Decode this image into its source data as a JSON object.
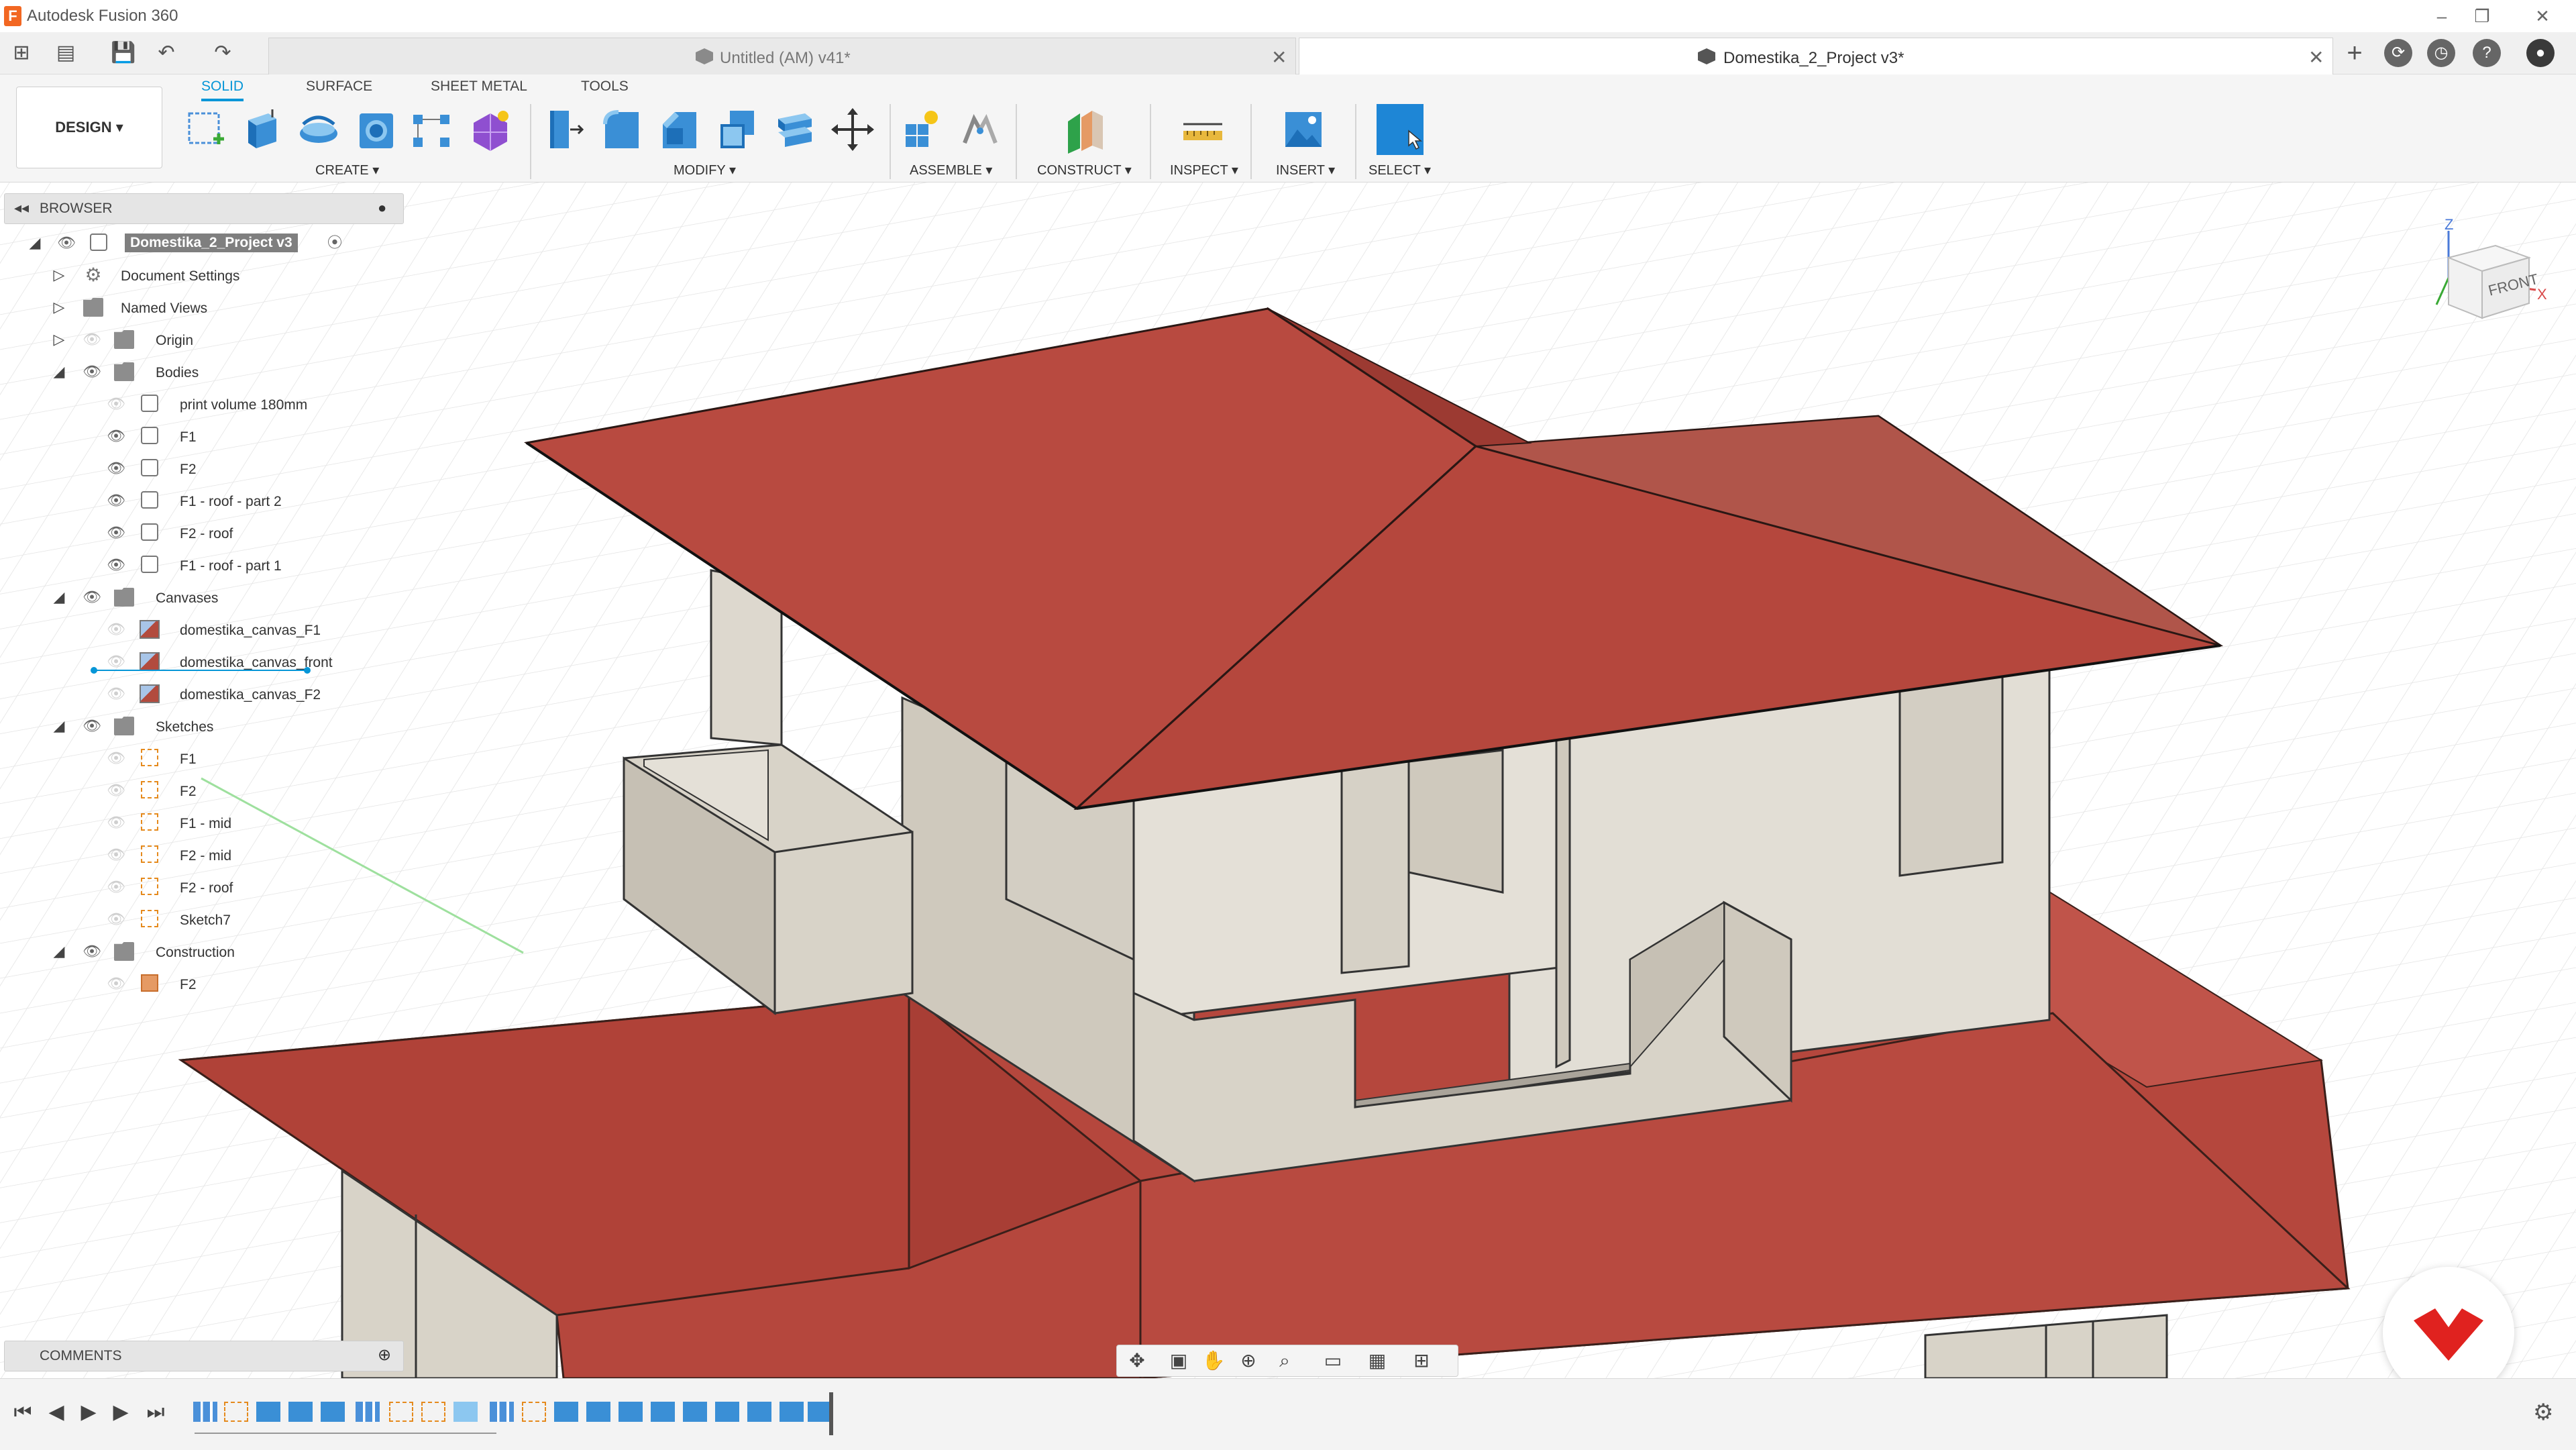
{
  "window": {
    "app_title": "Autodesk Fusion 360",
    "app_icon_letter": "F"
  },
  "tabs": [
    {
      "label": "Untitled (AM) v41*",
      "active": false
    },
    {
      "label": "Domestika_2_Project v3*",
      "active": true
    }
  ],
  "ribbon_tabs": [
    "SOLID",
    "SURFACE",
    "SHEET METAL",
    "TOOLS"
  ],
  "workspace_button": "DESIGN ▾",
  "toolbar_groups": {
    "create": "CREATE ▾",
    "modify": "MODIFY ▾",
    "assemble": "ASSEMBLE ▾",
    "construct": "CONSTRUCT ▾",
    "inspect": "INSPECT ▾",
    "insert": "INSERT ▾",
    "select": "SELECT ▾"
  },
  "browser": {
    "title": "BROWSER",
    "root": "Domestika_2_Project v3",
    "items": [
      {
        "label": "Document Settings"
      },
      {
        "label": "Named Views"
      },
      {
        "label": "Origin"
      },
      {
        "label": "Bodies"
      },
      {
        "label": "print volume 180mm"
      },
      {
        "label": "F1"
      },
      {
        "label": "F2"
      },
      {
        "label": "F1 - roof - part 2"
      },
      {
        "label": "F2 - roof"
      },
      {
        "label": "F1 - roof - part 1"
      },
      {
        "label": "Canvases"
      },
      {
        "label": "domestika_canvas_F1"
      },
      {
        "label": "domestika_canvas_front"
      },
      {
        "label": "domestika_canvas_F2"
      },
      {
        "label": "Sketches"
      },
      {
        "label": "F1"
      },
      {
        "label": "F2"
      },
      {
        "label": "F1 - mid"
      },
      {
        "label": "F2 - mid"
      },
      {
        "label": "F2 - roof"
      },
      {
        "label": "Sketch7"
      },
      {
        "label": "Construction"
      },
      {
        "label": "F2"
      }
    ]
  },
  "comments": {
    "title": "COMMENTS"
  },
  "viewcube": {
    "face": "FRONT",
    "axis_z": "Z",
    "axis_x": "X"
  },
  "colors": {
    "accent": "#0696d7",
    "roof": "#b5473d",
    "roof_dark": "#9c3a32",
    "roof_light": "#c75a4f",
    "wall": "#d8d3c8",
    "wall_shade": "#c6c0b4",
    "wall_light": "#e4e0d7",
    "brand": "#e0221f"
  },
  "icons": {
    "apps": "grid-icon",
    "file": "file-icon",
    "save": "save-icon",
    "undo": "undo-icon",
    "redo": "redo-icon",
    "new_tab": "plus-icon",
    "extensions": "extension-icon",
    "jobs": "clock-icon",
    "help": "help-icon",
    "settings": "gear-icon"
  }
}
